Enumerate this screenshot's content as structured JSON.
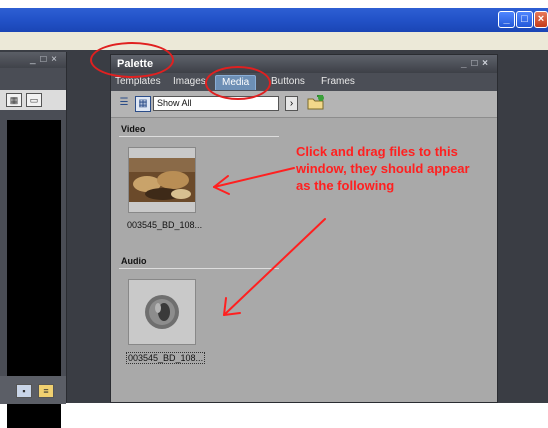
{
  "window_buttons": [
    "_",
    "□",
    "×"
  ],
  "left_panel": {
    "controls": "_ □ ×"
  },
  "palette": {
    "title": "Palette",
    "controls": "_ □ ×",
    "tabs": [
      "Templates",
      "Images",
      "Media",
      "Buttons",
      "Frames"
    ],
    "active_tab": "Media",
    "toolbar": {
      "select_value": "Show All",
      "go_label": "›"
    },
    "sections": [
      {
        "heading": "Video",
        "item_label": "003545_BD_108..."
      },
      {
        "heading": "Audio",
        "item_label": "003545_BD_108..."
      }
    ]
  },
  "annotation": {
    "text": "Click and drag files to this window, they should appear as the following",
    "color": "#ff2020"
  },
  "icons": [
    "chevron-right-icon",
    "folder-add-icon",
    "speaker-icon",
    "list-view-icon",
    "grid-view-icon"
  ],
  "colors": {
    "titlebar": "#2353c9",
    "panel": "#a9a9a9",
    "active_tab": "#6d8fb5",
    "annotation_circle": "#e02020"
  }
}
